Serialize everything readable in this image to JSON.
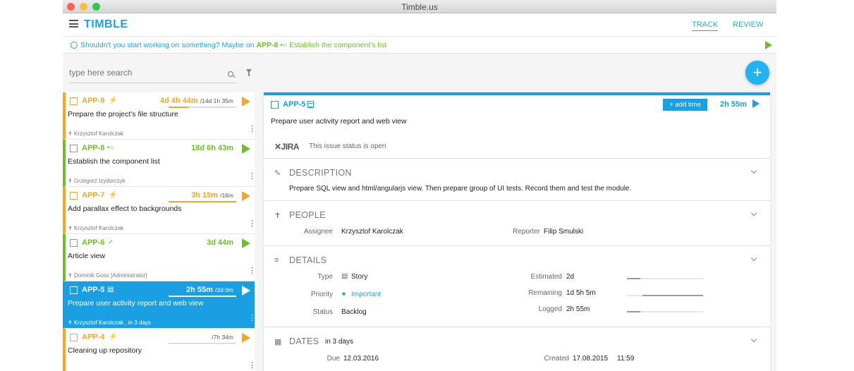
{
  "window": {
    "title": "Timble.us"
  },
  "app": {
    "logo": "TIMBLE",
    "tabs": {
      "track": "TRACK",
      "review": "REVIEW"
    }
  },
  "notice": {
    "prefix": "Shouldn't you start working on something? Maybe on ",
    "key": "APP-8",
    "icon": "•○",
    "title": " Establish the component's list"
  },
  "search": {
    "placeholder": "type here search"
  },
  "fab": {
    "label": "+"
  },
  "tasks": [
    {
      "key": "APP-9",
      "icon": "⚡",
      "time": "4d 4h 44m",
      "estimate": "/14d 1h 35m",
      "progress": 0.3,
      "title": "Prepare the project's file structure",
      "assignee": "✝ Krzysztof Karolczak",
      "more": "⋮"
    },
    {
      "key": "APP-8",
      "icon": "•○",
      "time": "18d 6h 43m",
      "estimate": "",
      "title": "Establish the component list",
      "assignee": "✝ Grzegorz Izydorczyk",
      "more": "⋮"
    },
    {
      "key": "APP-7",
      "icon": "⚡",
      "time": "3h 15m",
      "estimate": "/16m",
      "progress": 1.0,
      "title": "Add parallax effect to backgrounds",
      "assignee": "✝ Krzysztof Karolczak",
      "more": "⋮"
    },
    {
      "key": "APP-6",
      "icon": "✓",
      "time": "3d 44m",
      "estimate": "",
      "title": "Article view",
      "assignee": "✝ Dominik Goss [Administrator]",
      "more": "⋮"
    },
    {
      "key": "APP-5",
      "icon": "▤",
      "time": "2h 55m",
      "estimate": "/2d 0m",
      "progress": 0.15,
      "title": "Prepare user activity report and web view",
      "assignee": "✝ Krzysztof Karolczak , in 3 days",
      "more": "⋮"
    },
    {
      "key": "APP-4",
      "icon": "⚡",
      "time": "",
      "estimate": "/7h 34m",
      "progress": 0,
      "title": "Cleaning up repository",
      "assignee": "",
      "more": "⋮"
    }
  ],
  "detail": {
    "key": "APP-5",
    "add_time": "+ add time",
    "duration": "2h 55m",
    "title": "Prepare user activity report and web view",
    "jira": "✕JIRA",
    "status_text": "This issue status is open",
    "description": {
      "header": "DESCRIPTION",
      "icon": "✎",
      "text": "Prepare SQL view and html/angularjs view. Then prepare group of UI tests. Record them and test the module."
    },
    "people": {
      "header": "PEOPLE",
      "icon": "✝",
      "assignee_label": "Assignee",
      "assignee": "Krzysztof Karolczak",
      "reporter_label": "Reporter",
      "reporter": "Filip Smulski"
    },
    "details": {
      "header": "DETAILS",
      "icon": "≡",
      "type_label": "Type",
      "type_icon": "▤",
      "type": "Story",
      "priority_label": "Priority",
      "priority_icon": "■",
      "priority": "Important",
      "status_label": "Status",
      "status": "Backlog",
      "estimated_label": "Estimated",
      "estimated": "2d",
      "estimated_fill": 0.18,
      "remaining_label": "Remaining",
      "remaining": "1d 5h 5m",
      "remaining_fill": 0.8,
      "logged_label": "Logged",
      "logged": "2h 55m",
      "logged_fill": 0.18
    },
    "dates": {
      "header": "DATES",
      "icon": "▦",
      "relative": "in 3 days",
      "due_label": "Due",
      "due": "12.03.2016",
      "created_label": "Created",
      "created": "17.08.2015",
      "created_time": "11:59"
    }
  },
  "colors": {
    "accent": "#1a9fe3",
    "orange": "#f5a623",
    "green": "#6cbf2b"
  }
}
